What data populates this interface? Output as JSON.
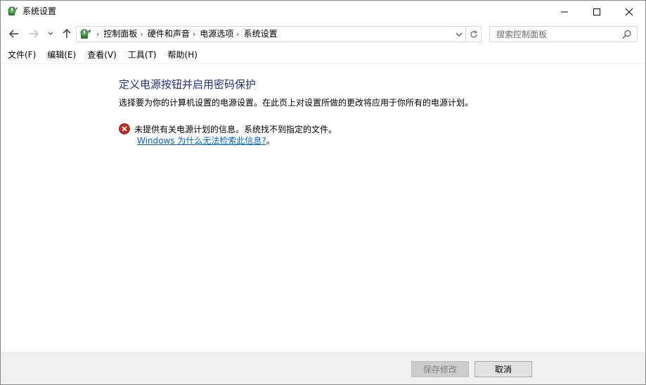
{
  "window": {
    "title": "系统设置",
    "icon": "control-panel-power-icon"
  },
  "caption_buttons": {
    "minimize_icon": "minimize-icon",
    "maximize_icon": "maximize-icon",
    "close_icon": "close-icon"
  },
  "navigation": {
    "back_icon": "arrow-left-icon",
    "forward_icon": "arrow-right-icon",
    "recent_icon": "chevron-down-icon",
    "up_icon": "arrow-up-icon"
  },
  "address": {
    "breadcrumbs": [
      "控制面板",
      "硬件和声音",
      "电源选项",
      "系统设置"
    ],
    "separator": "›"
  },
  "search": {
    "placeholder": "搜索控制面板",
    "value": ""
  },
  "menu": {
    "items": [
      "文件(F)",
      "编辑(E)",
      "查看(V)",
      "工具(T)",
      "帮助(H)"
    ]
  },
  "content": {
    "heading": "定义电源按钮并启用密码保护",
    "description": "选择要为你的计算机设置的电源设置。在此页上对设置所做的更改将应用于你所有的电源计划。",
    "error": {
      "message": "未提供有关电源计划的信息。系统找不到指定的文件。",
      "link_text": "Windows 为什么无法检索此信息?",
      "link_suffix": "。"
    }
  },
  "footer": {
    "save_label": "保存修改",
    "cancel_label": "取消"
  },
  "colors": {
    "heading": "#1e3287",
    "link": "#0066cc",
    "error_red": "#c42b1c",
    "footer_bg": "#f0f0f0"
  }
}
